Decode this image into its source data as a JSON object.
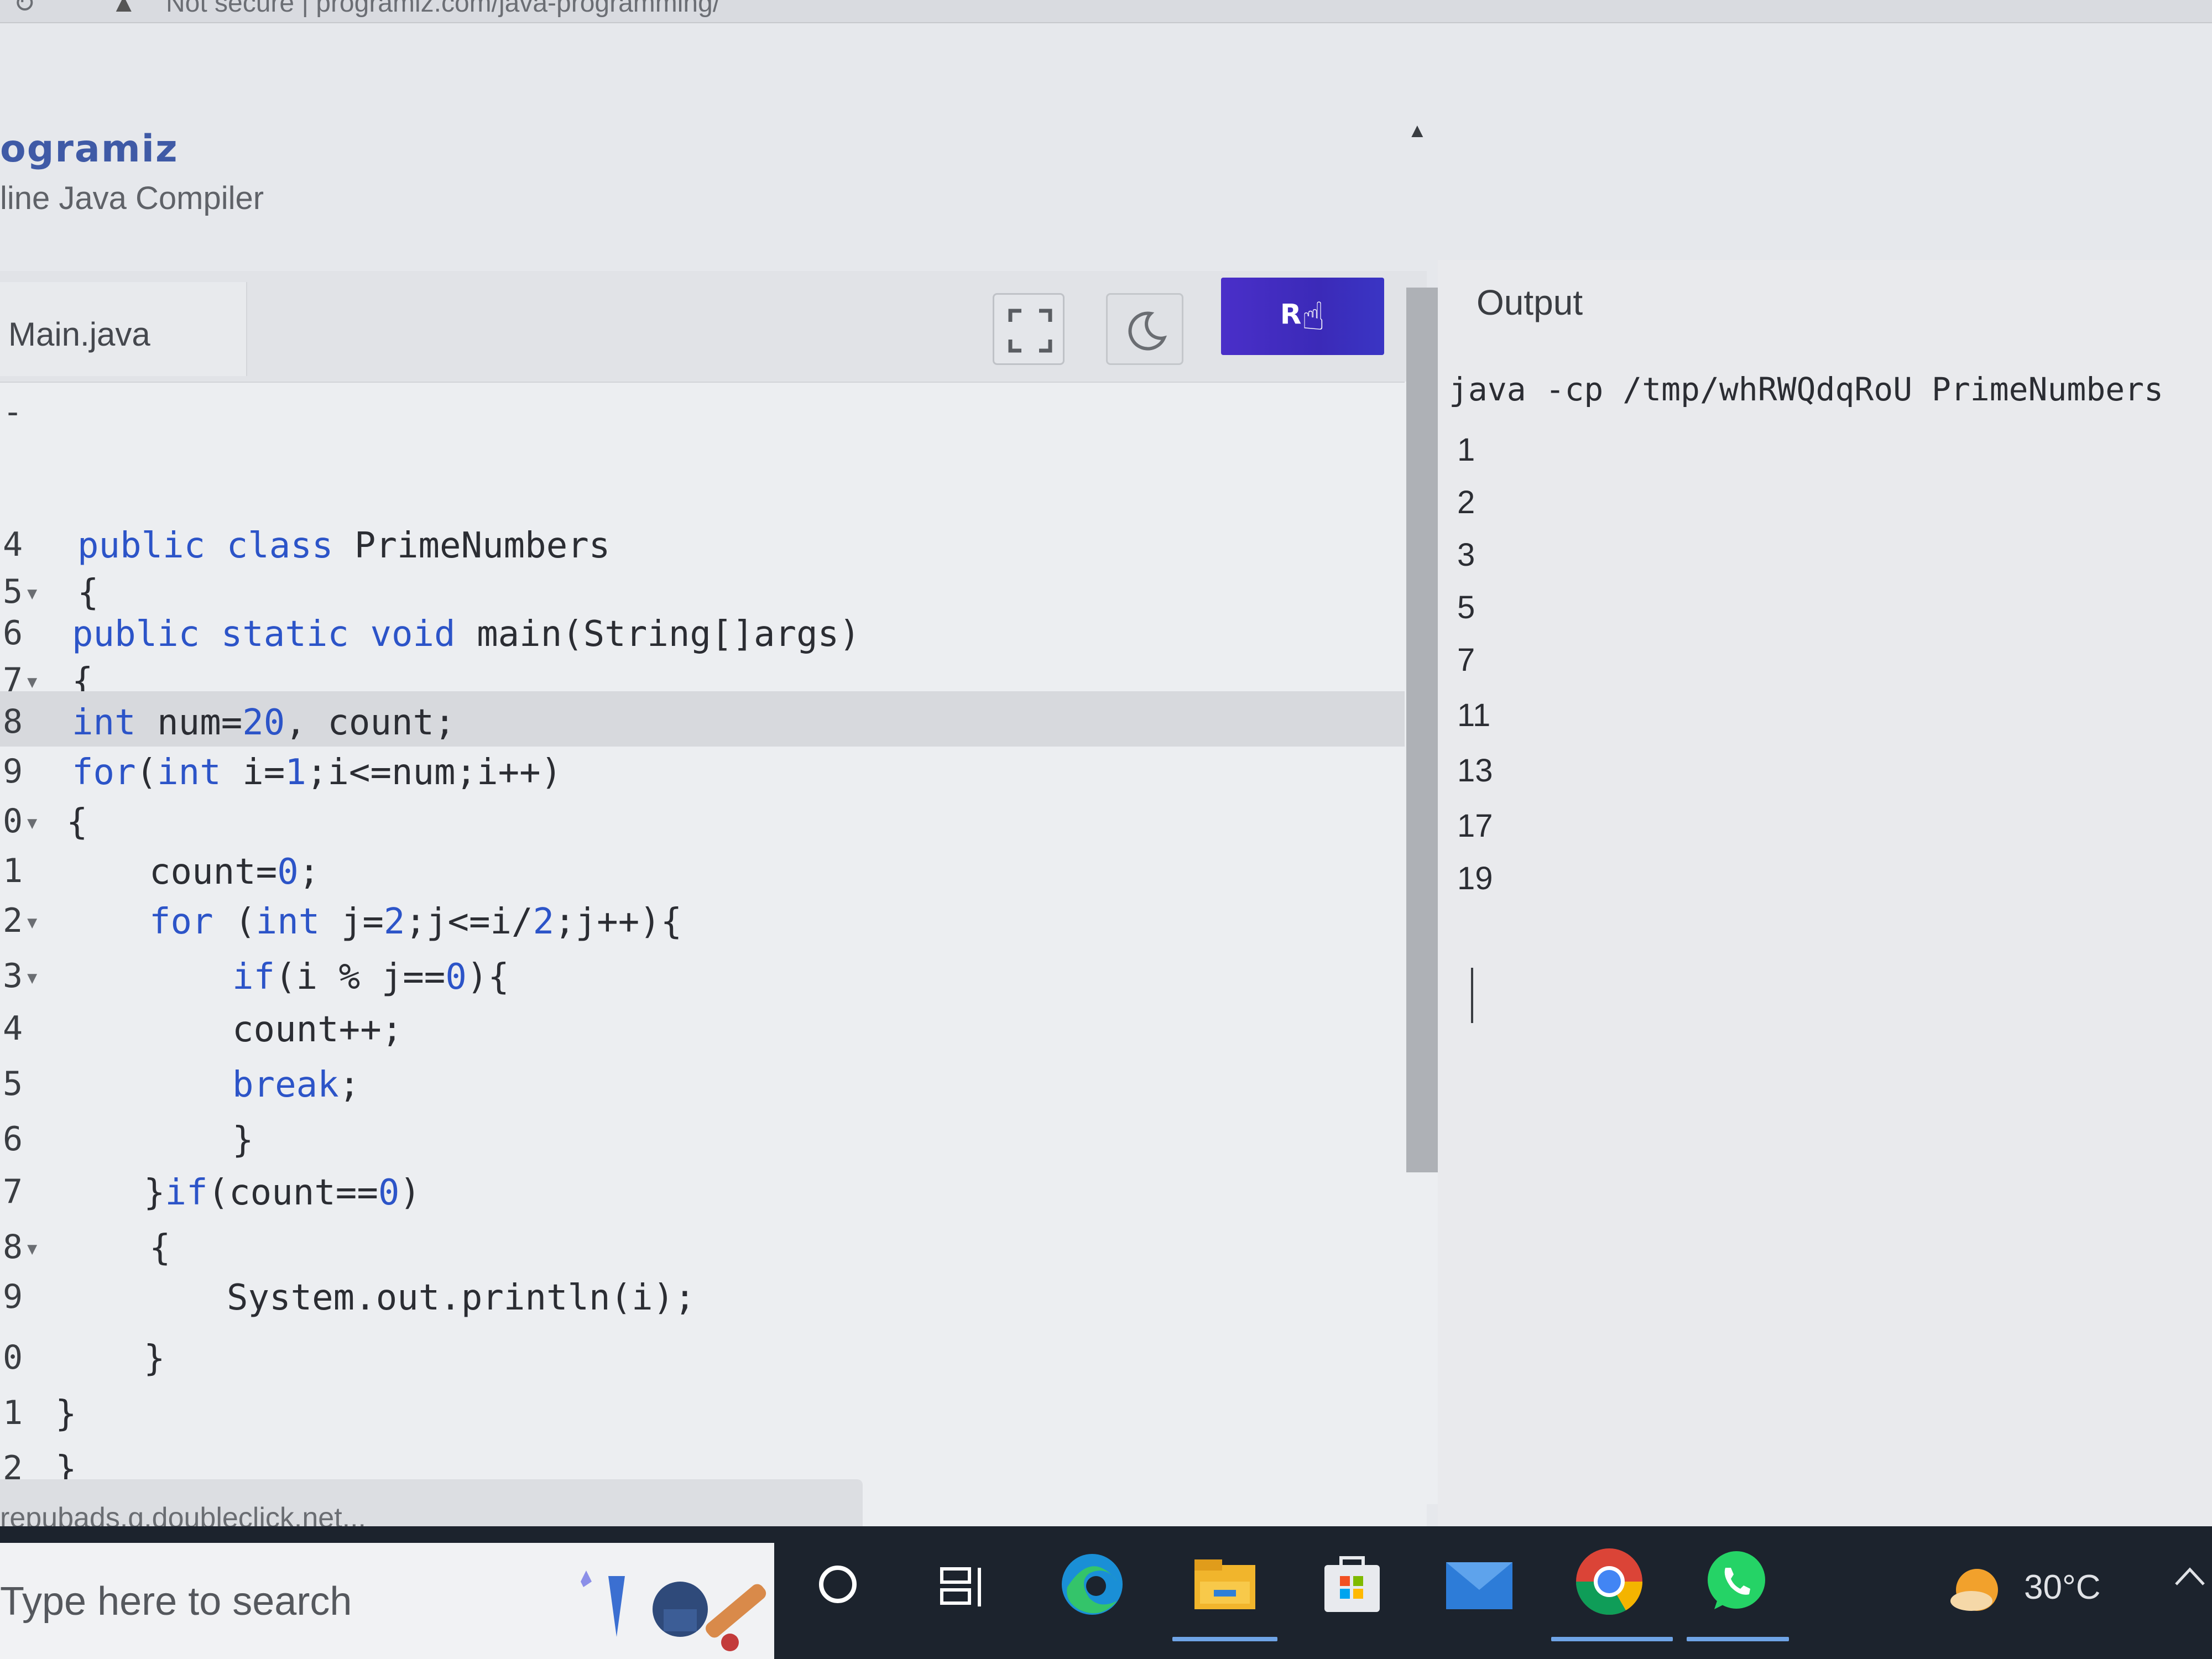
{
  "browser": {
    "security_label": "Not secure",
    "url": "programiz.com/java-programming/"
  },
  "site": {
    "brand": "ogramiz",
    "subtitle": "line Java Compiler"
  },
  "editor": {
    "file_tab": "Main.java",
    "run_label": "R",
    "lines": [
      {
        "num": "-",
        "text": ""
      },
      {
        "num": "4",
        "text": "public class PrimeNumbers"
      },
      {
        "num": "5",
        "text": "{"
      },
      {
        "num": "6",
        "text": "public static void main(String[]args)"
      },
      {
        "num": "7",
        "text": "{"
      },
      {
        "num": "8",
        "text": "int num=20, count;"
      },
      {
        "num": "9",
        "text": "for(int i=1;i<=num;i++)"
      },
      {
        "num": "0",
        "text": "{"
      },
      {
        "num": "1",
        "text": "count=0;"
      },
      {
        "num": "2",
        "text": "for (int j=2;j<=i/2;j++){"
      },
      {
        "num": "3",
        "text": "if(i % j==0){"
      },
      {
        "num": "4",
        "text": "count++;"
      },
      {
        "num": "5",
        "text": "break;"
      },
      {
        "num": "6",
        "text": "}"
      },
      {
        "num": "7",
        "text": "}if(count==0)"
      },
      {
        "num": "8",
        "text": "{"
      },
      {
        "num": "9",
        "text": "System.out.println(i);"
      },
      {
        "num": "0",
        "text": "}"
      },
      {
        "num": "1",
        "text": "}"
      },
      {
        "num": "2",
        "text": "}"
      }
    ]
  },
  "output": {
    "header": "Output",
    "command": "java -cp /tmp/whRWQdqRoU PrimeNumbers",
    "lines": [
      "1",
      "2",
      "3",
      "5",
      "7",
      "11",
      "13",
      "17",
      "19"
    ]
  },
  "status_bar": {
    "link_text": "repubads.g.doubleclick.net..."
  },
  "taskbar": {
    "search_placeholder": "Type here to search",
    "weather_temp": "30°C",
    "icons": [
      "cortana-icon",
      "task-view-icon",
      "edge-icon",
      "file-explorer-icon",
      "microsoft-store-icon",
      "mail-icon",
      "chrome-icon",
      "whatsapp-icon"
    ]
  }
}
